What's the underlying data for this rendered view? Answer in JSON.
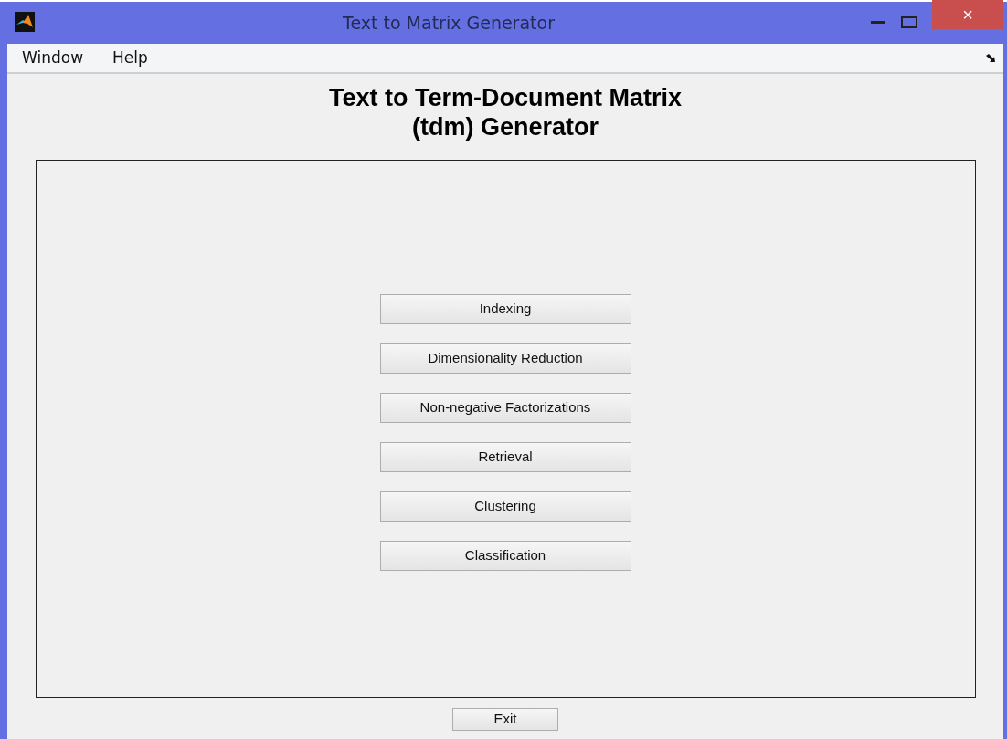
{
  "window": {
    "title": "Text to Matrix Generator",
    "close": "×"
  },
  "menu": [
    "Window",
    "Help"
  ],
  "heading": [
    "Text to Term-Document Matrix",
    "(tdm) Generator"
  ],
  "buttons": [
    "Indexing",
    "Dimensionality Reduction",
    "Non-negative Factorizations",
    "Retrieval",
    "Clustering",
    "Classification"
  ],
  "exit": "Exit"
}
